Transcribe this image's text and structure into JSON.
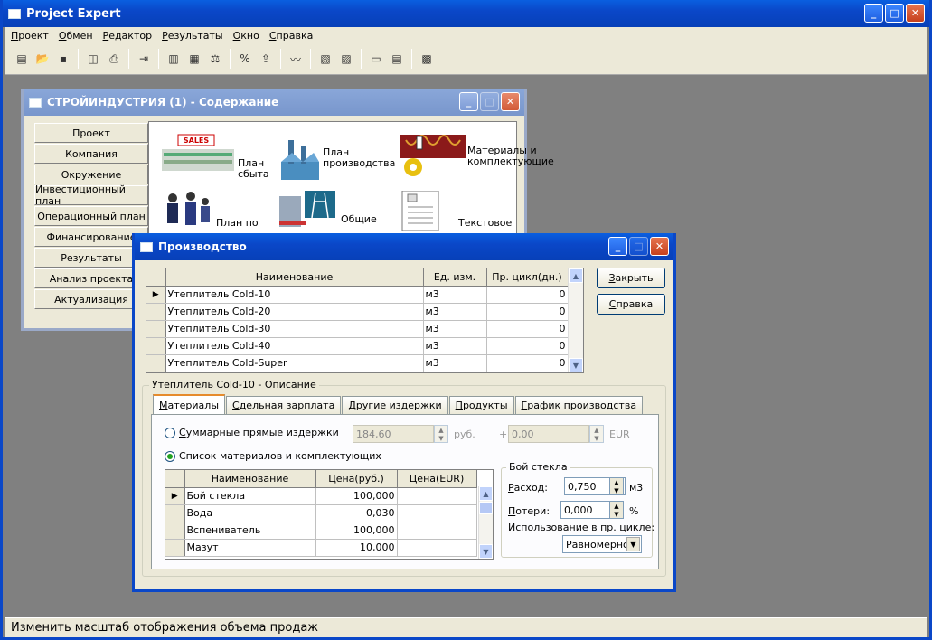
{
  "app": {
    "title": "Project Expert",
    "status": "Изменить масштаб отображения объема продаж"
  },
  "menu": [
    "Проект",
    "Обмен",
    "Редактор",
    "Результаты",
    "Окно",
    "Справка"
  ],
  "toolbar": [
    [
      "new-icon",
      "▤"
    ],
    [
      "open-icon",
      "📂"
    ],
    [
      "save-icon",
      "▪"
    ],
    "sep",
    [
      "preview-icon",
      "◫"
    ],
    [
      "print-icon",
      "⎙"
    ],
    "sep",
    [
      "exit-icon",
      "⇥"
    ],
    "sep",
    [
      "cashflow-icon",
      "▥"
    ],
    [
      "cf-icon",
      "▦"
    ],
    [
      "balance-icon",
      "⚖"
    ],
    "sep",
    [
      "percent-icon",
      "%"
    ],
    [
      "export-icon",
      "⇪"
    ],
    "sep",
    [
      "chart-icon",
      "〰"
    ],
    "sep",
    [
      "report-icon",
      "▧"
    ],
    [
      "doc-icon",
      "▨"
    ],
    "sep",
    [
      "table-icon",
      "▭"
    ],
    [
      "list-icon",
      "▤"
    ],
    "sep",
    [
      "calc-icon",
      "▩"
    ]
  ],
  "content_window": {
    "title": "СТРОЙИНДУСТРИЯ (1) - Содержание",
    "nav": [
      "Проект",
      "Компания",
      "Окружение",
      "Инвестиционный план",
      "Операционный план",
      "Финансирование",
      "Результаты",
      "Анализ проекта",
      "Актуализация"
    ],
    "links": {
      "sales": "План сбыта",
      "production": "План производства",
      "materials": "Материалы и комплектующие",
      "personnel": "План по",
      "general": "Общие",
      "text": "Текстовое"
    },
    "sales_banner": "SALES"
  },
  "dialog": {
    "title": "Производство",
    "close_button": "Закрыть",
    "help_button": "Справка",
    "products": {
      "headers": [
        "Наименование",
        "Ед. изм.",
        "Пр. цикл(дн.)"
      ],
      "rows": [
        {
          "name": "Утеплитель Cold-10",
          "unit": "м3",
          "cycle": "0"
        },
        {
          "name": "Утеплитель Cold-20",
          "unit": "м3",
          "cycle": "0"
        },
        {
          "name": "Утеплитель Cold-30",
          "unit": "м3",
          "cycle": "0"
        },
        {
          "name": "Утеплитель Cold-40",
          "unit": "м3",
          "cycle": "0"
        },
        {
          "name": "Утеплитель Cold-Super",
          "unit": "м3",
          "cycle": "0"
        }
      ]
    },
    "group_title": "Утеплитель Cold-10 - Описание",
    "tabs": [
      "Материалы",
      "Сдельная зарплата",
      "Другие издержки",
      "Продукты",
      "График производства"
    ],
    "radio_total": "Суммарные прямые издержки",
    "radio_list": "Список материалов и комплектующих",
    "total_value": "184,60",
    "total_unit": "руб.",
    "eur_plus": "+",
    "eur_value": "0,00",
    "eur_unit": "EUR",
    "materials": {
      "headers": [
        "Наименование",
        "Цена(руб.)",
        "Цена(EUR)"
      ],
      "rows": [
        {
          "name": "Бой стекла",
          "price": "100,000",
          "eur": ""
        },
        {
          "name": "Вода",
          "price": "0,030",
          "eur": ""
        },
        {
          "name": "Вспениватель",
          "price": "100,000",
          "eur": ""
        },
        {
          "name": "Мазут",
          "price": "10,000",
          "eur": ""
        }
      ]
    },
    "detail": {
      "title": "Бой стекла",
      "consumption_label": "Расход:",
      "consumption_value": "0,750",
      "consumption_unit": "м3",
      "loss_label": "Потери:",
      "loss_value": "0,000",
      "loss_unit": "%",
      "usage_label": "Использование в пр. цикле:",
      "usage_value": "Равномерно"
    }
  }
}
